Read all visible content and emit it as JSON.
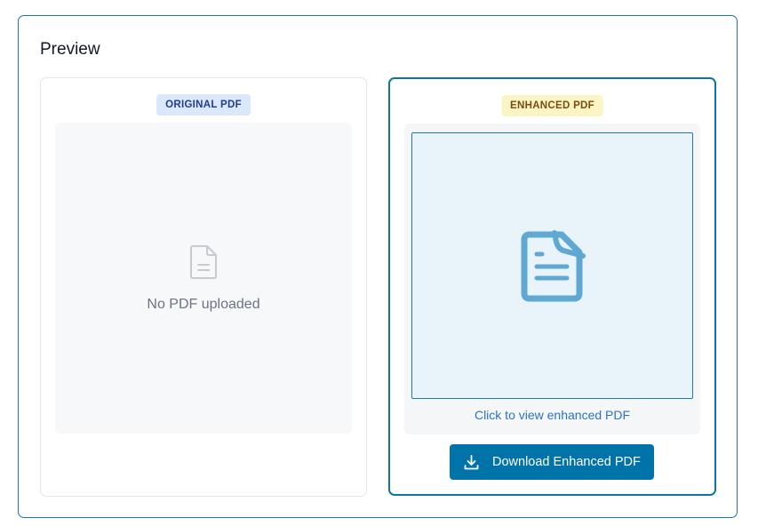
{
  "preview": {
    "title": "Preview"
  },
  "original": {
    "badge": "ORIGINAL PDF",
    "empty_text": "No PDF uploaded",
    "icon": "file-icon"
  },
  "enhanced": {
    "badge": "ENHANCED PDF",
    "icon": "document-icon",
    "view_link": "Click to view enhanced PDF",
    "download_label": "Download Enhanced PDF",
    "download_icon": "download-icon"
  },
  "colors": {
    "accent": "#0073a8",
    "border": "#1a78a8",
    "badge_original_bg": "#dbe8fc",
    "badge_original_text": "#1f3d8f",
    "badge_enhanced_bg": "#fbf4c5",
    "badge_enhanced_text": "#7a4d0d",
    "doc_icon": "#5fa8d3"
  }
}
